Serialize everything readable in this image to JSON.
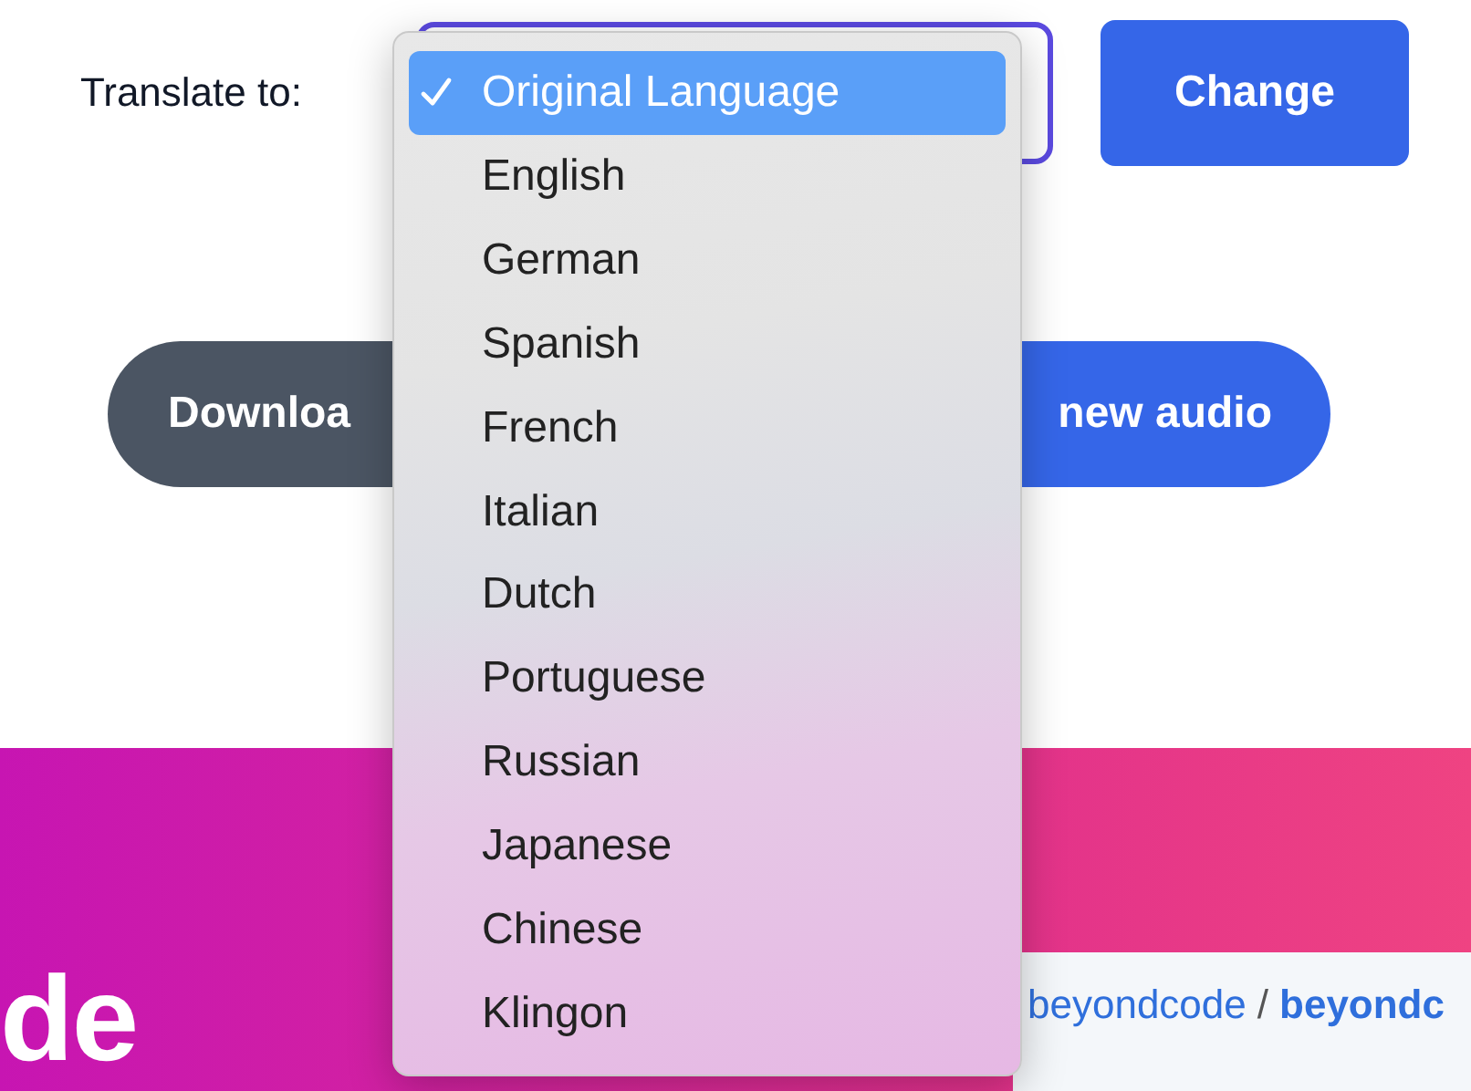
{
  "form": {
    "label": "Translate to:",
    "button": "Change"
  },
  "actions": [
    {
      "kind": "secondary",
      "label": "Downloa"
    },
    {
      "kind": "primary",
      "label": "new audio"
    }
  ],
  "banner": {
    "heading": "de",
    "breadcrumb": [
      {
        "text": "beyondcode",
        "bold": false
      },
      {
        "text": "/",
        "bold": false
      },
      {
        "text": "beyondc",
        "bold": true
      }
    ]
  },
  "dropdown": {
    "items": [
      {
        "label": "Original Language",
        "selected": true
      },
      {
        "label": "English",
        "selected": false
      },
      {
        "label": "German",
        "selected": false
      },
      {
        "label": "Spanish",
        "selected": false
      },
      {
        "label": "French",
        "selected": false
      },
      {
        "label": "Italian",
        "selected": false
      },
      {
        "label": "Dutch",
        "selected": false
      },
      {
        "label": "Portuguese",
        "selected": false
      },
      {
        "label": "Russian",
        "selected": false
      },
      {
        "label": "Japanese",
        "selected": false
      },
      {
        "label": "Chinese",
        "selected": false
      },
      {
        "label": "Klingon",
        "selected": false
      }
    ]
  }
}
